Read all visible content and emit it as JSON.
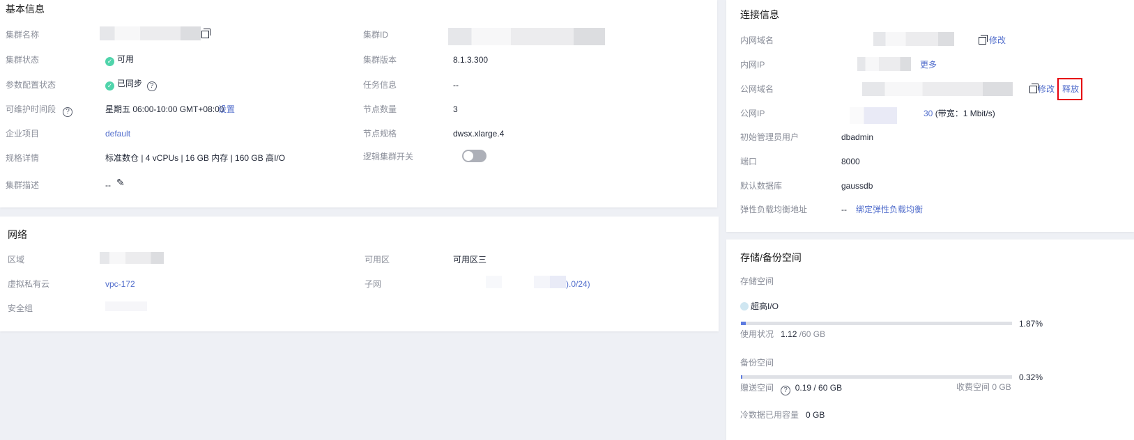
{
  "basic": {
    "title": "基本信息",
    "cluster_name_label": "集群名称",
    "cluster_status_label": "集群状态",
    "cluster_status": "可用",
    "param_status_label": "参数配置状态",
    "param_status": "已同步",
    "maint_label": "可维护时间段",
    "maint_value": "星期五 06:00-10:00 GMT+08:00",
    "maint_set": "设置",
    "project_label": "企业项目",
    "project_value": "default",
    "spec_label": "规格详情",
    "spec_value": "标准数仓 | 4 vCPUs | 16 GB 内存 | 160 GB 高I/O",
    "desc_label": "集群描述",
    "desc_value": "--",
    "cluster_id_label": "集群ID",
    "version_label": "集群版本",
    "version_value": "8.1.3.300",
    "task_label": "任务信息",
    "task_value": "--",
    "nodes_label": "节点数量",
    "nodes_value": "3",
    "node_spec_label": "节点规格",
    "node_spec_value": "dwsx.xlarge.4",
    "logical_label": "逻辑集群开关",
    "logical_enabled": false
  },
  "network": {
    "title": "网络",
    "region_label": "区域",
    "az_label": "可用区",
    "az_value": "可用区三",
    "vpc_label": "虚拟私有云",
    "vpc_value": "vpc-172",
    "subnet_label": "子网",
    "subnet_value_partial": ").0/24)",
    "sg_label": "安全组"
  },
  "connection": {
    "title": "连接信息",
    "private_domain_label": "内网域名",
    "modify": "修改",
    "private_ip_label": "内网IP",
    "more": "更多",
    "public_domain_label": "公网域名",
    "release": "释放",
    "public_ip_label": "公网IP",
    "public_ip_partial": "30",
    "bandwidth": "(带宽：1 Mbit/s)",
    "admin_label": "初始管理员用户",
    "admin_value": "dbadmin",
    "port_label": "端口",
    "port_value": "8000",
    "db_label": "默认数据库",
    "db_value": "gaussdb",
    "elb_label": "弹性负载均衡地址",
    "elb_value": "--",
    "elb_bind": "绑定弹性负载均衡"
  },
  "storage": {
    "title": "存储/备份空间",
    "storage_label": "存储空间",
    "type": "超高I/O",
    "storage_percent": 1.87,
    "storage_percent_text": "1.87%",
    "usage_label": "使用状况",
    "usage_used": "1.12",
    "usage_total": "/60 GB",
    "backup_label": "备份空间",
    "backup_percent": 0.32,
    "backup_percent_text": "0.32%",
    "free_label": "赠送空间",
    "free_value": "0.19 / 60 GB",
    "paid_label": "收费空间",
    "paid_value": "0 GB",
    "cold_label": "冷数据已用容量",
    "cold_value": "0 GB"
  }
}
